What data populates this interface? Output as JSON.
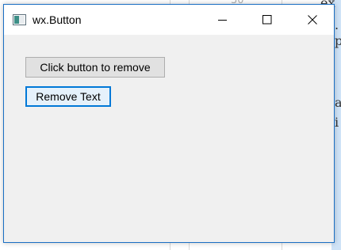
{
  "desktop": {
    "partial_number": "30",
    "glyphs": [
      "ex",
      ".",
      "p",
      "a",
      "i"
    ]
  },
  "window": {
    "title": "wx.Button",
    "icon": "app-window-icon",
    "controls": {
      "minimize": "minimize-icon",
      "maximize": "maximize-icon",
      "close": "close-icon"
    }
  },
  "content": {
    "target_button_label": "Click button to remove",
    "remove_button_label": "Remove Text"
  },
  "colors": {
    "accent": "#0078d7",
    "window_border": "#1a6fc4",
    "client_bg": "#f0f0f0"
  }
}
